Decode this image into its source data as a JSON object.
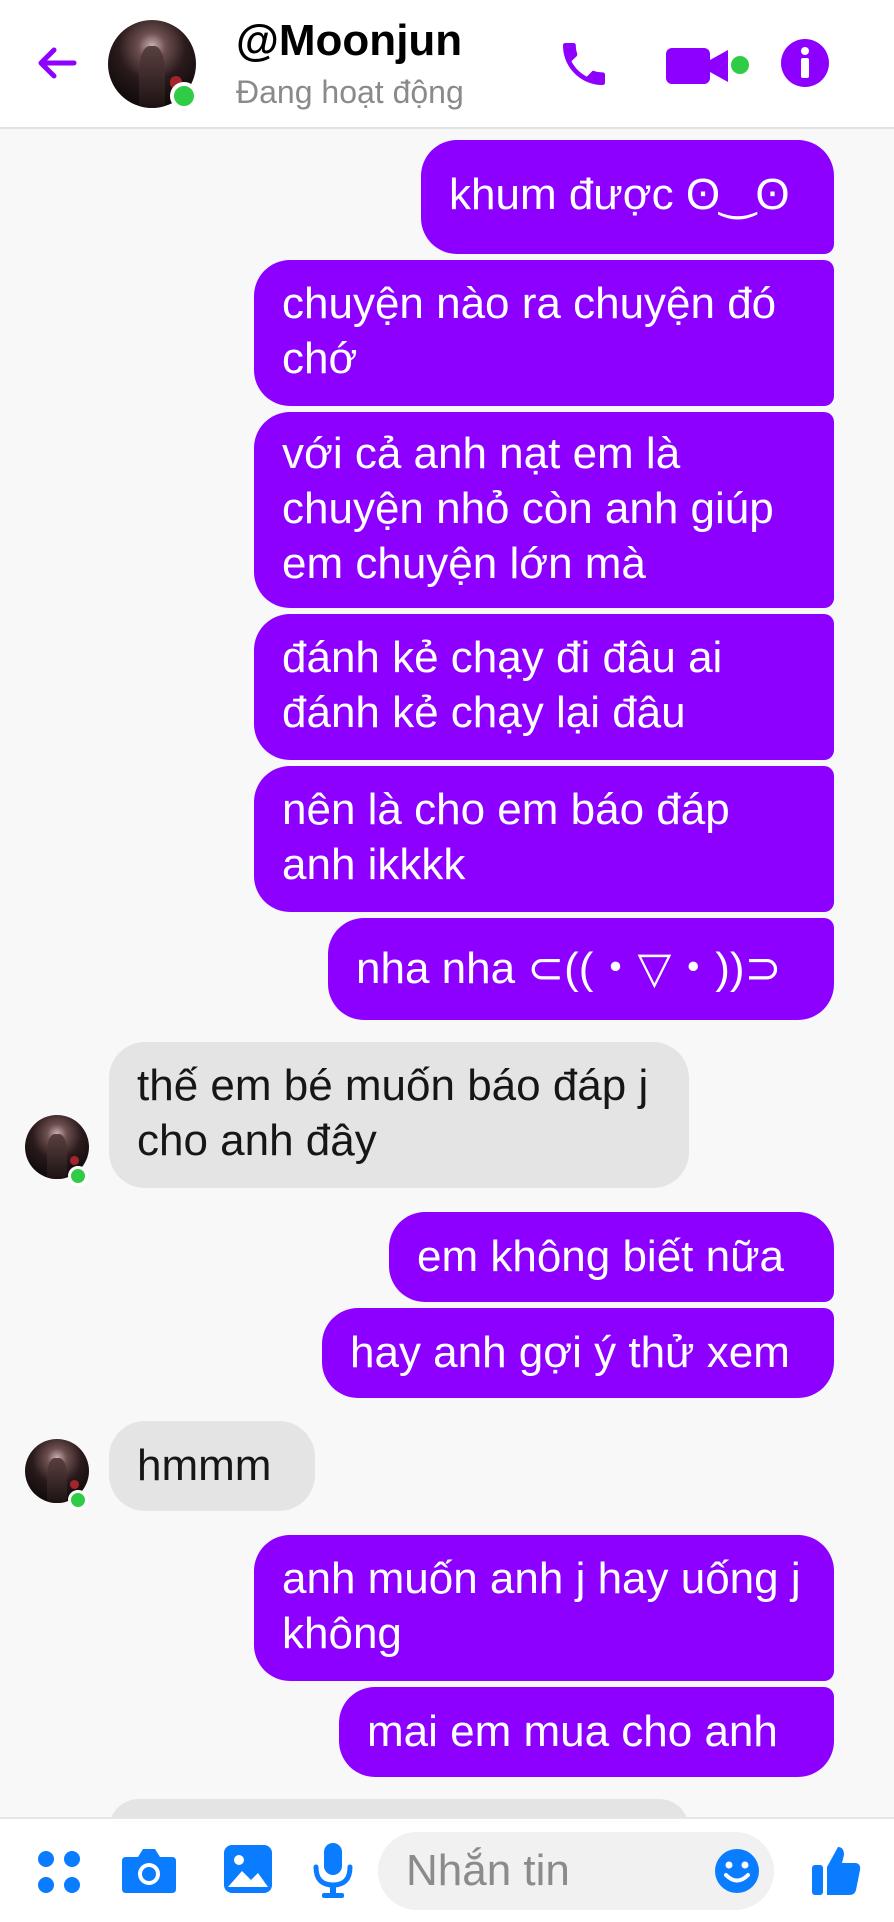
{
  "header": {
    "back_icon": "arrow-left-icon",
    "contact_name": "@Moonjun",
    "status": "Đang hoạt động",
    "actions": [
      "phone-icon",
      "video-camera-icon",
      "info-icon"
    ],
    "accent_color": "#8d00ff",
    "online_color": "#31cc46"
  },
  "messages": [
    {
      "from": "me",
      "text": "khum được ʘ‿ʘ"
    },
    {
      "from": "me",
      "text": "chuyện nào ra chuyện đó chớ"
    },
    {
      "from": "me",
      "text": "với cả anh nạt em là chuyện nhỏ còn anh giúp em chuyện lớn mà"
    },
    {
      "from": "me",
      "text": "đánh kẻ chạy đi đâu ai đánh kẻ chạy lại đâu"
    },
    {
      "from": "me",
      "text": "nên là cho em báo đáp anh ikkkk"
    },
    {
      "from": "me",
      "text": "nha nha ⊂((・▽・))⊃"
    },
    {
      "from": "them",
      "text": "thế em bé muốn báo đáp j cho anh đây"
    },
    {
      "from": "me",
      "text": "em không biết nữa"
    },
    {
      "from": "me",
      "text": "hay anh gợi ý thử xem"
    },
    {
      "from": "them",
      "text": "hmmm"
    },
    {
      "from": "me",
      "text": "anh muốn anh j hay uống j không"
    },
    {
      "from": "me",
      "text": "mai em mua cho anh"
    }
  ],
  "composer": {
    "icons": [
      "apps-icon",
      "camera-icon",
      "image-icon",
      "microphone-icon"
    ],
    "placeholder": "Nhắn tin",
    "emoji_icon": "smiley-icon",
    "like_icon": "thumbs-up-icon",
    "icon_color": "#0a7cff"
  }
}
